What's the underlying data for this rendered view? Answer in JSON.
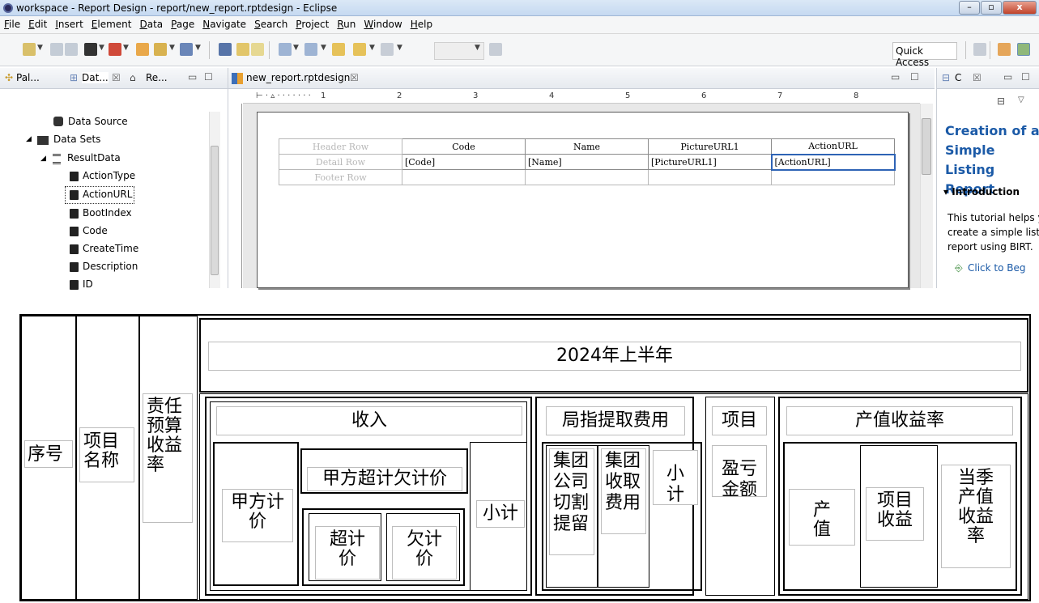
{
  "window": {
    "title": "workspace - Report Design - report/new_report.rptdesign - Eclipse",
    "controls": [
      "–",
      "▫",
      "x"
    ]
  },
  "menu": [
    "File",
    "Edit",
    "Insert",
    "Element",
    "Data",
    "Page",
    "Navigate",
    "Search",
    "Project",
    "Run",
    "Window",
    "Help"
  ],
  "toolbar": {
    "quick_access": "Quick Access"
  },
  "left_pane": {
    "tabs": [
      "Pal...",
      "Dat...",
      "Re..."
    ],
    "tree": {
      "data_source": "Data Source",
      "data_sets": "Data Sets",
      "result": "ResultData",
      "columns": [
        "ActionType",
        "ActionURL",
        "BootIndex",
        "Code",
        "CreateTime",
        "Description",
        "ID"
      ]
    }
  },
  "editor": {
    "tab": "new_report.rptdesign",
    "ruler": [
      "1",
      "2",
      "3",
      "4",
      "5",
      "6",
      "7",
      "8"
    ],
    "report_table": {
      "row_labels": [
        "Header Row",
        "Detail Row",
        "Footer Row"
      ],
      "headers": [
        "Code",
        "Name",
        "PictureURL1",
        "ActionURL"
      ],
      "details": [
        "[Code]",
        "[Name]",
        "[PictureURL1]",
        "[ActionURL]"
      ]
    }
  },
  "right_pane": {
    "tab": "C",
    "title": "Creation of a Simple Listing Report",
    "section": "Introduction",
    "text": [
      "This tutorial helps y",
      "create a simple listi",
      "report using BIRT."
    ],
    "link": "Click to Beg"
  },
  "grid_table": {
    "col_seq": "序号",
    "col_name": "项目名称",
    "col_budget": "责任预算收益率",
    "period": "2024年上半年",
    "income": {
      "title": "收入",
      "party_a_price": "甲方计价",
      "over_under": "甲方超计欠计价",
      "over": "超计价",
      "under": "欠计价",
      "subtotal": "小计"
    },
    "fees": {
      "title": "局指提取费用",
      "group_cut": "集团公司切割提留",
      "group_fee": "集团收取费用",
      "subtotal": "小计"
    },
    "project": {
      "title": "项目",
      "profit": "盈亏金额"
    },
    "output_yield": {
      "title": "产值收益率",
      "output": "产值",
      "project_income": "项目收益",
      "quarter_yield": "当季产值收益率"
    }
  }
}
